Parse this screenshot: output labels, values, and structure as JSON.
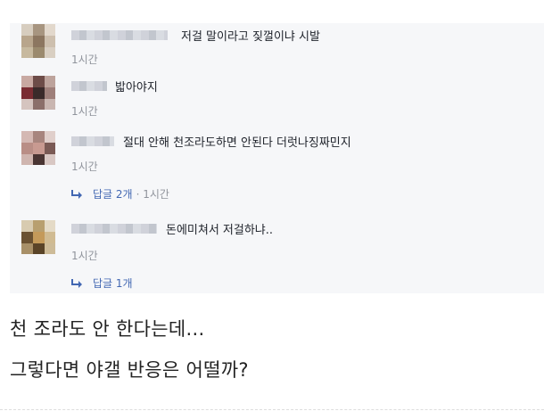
{
  "thread": {
    "comments": [
      {
        "text": "저걸 말이라고 짖껄이냐 시발",
        "time": "1시간"
      },
      {
        "text": "밟아야지",
        "time": "1시간"
      },
      {
        "text": "절대 안해 천조라도하면 안된다 더럿나징짜민지",
        "time": "1시간",
        "reply": {
          "label": "답글 2개",
          "meta": "· 1시간"
        }
      },
      {
        "text": "돈에미쳐서 저걸하냐..",
        "time": "1시간",
        "reply": {
          "label": "답글 1개",
          "meta": ""
        }
      }
    ]
  },
  "captions": [
    "천 조라도 안 한다는데...",
    "그렇다면 야갤 반응은 어떨까?"
  ],
  "colors": {
    "panel_bg": "#f6f7f9",
    "text": "#1d2129",
    "timestamp": "#90949c",
    "reply_link": "#4267b2"
  },
  "icons": [
    "reply-arrow-icon"
  ]
}
